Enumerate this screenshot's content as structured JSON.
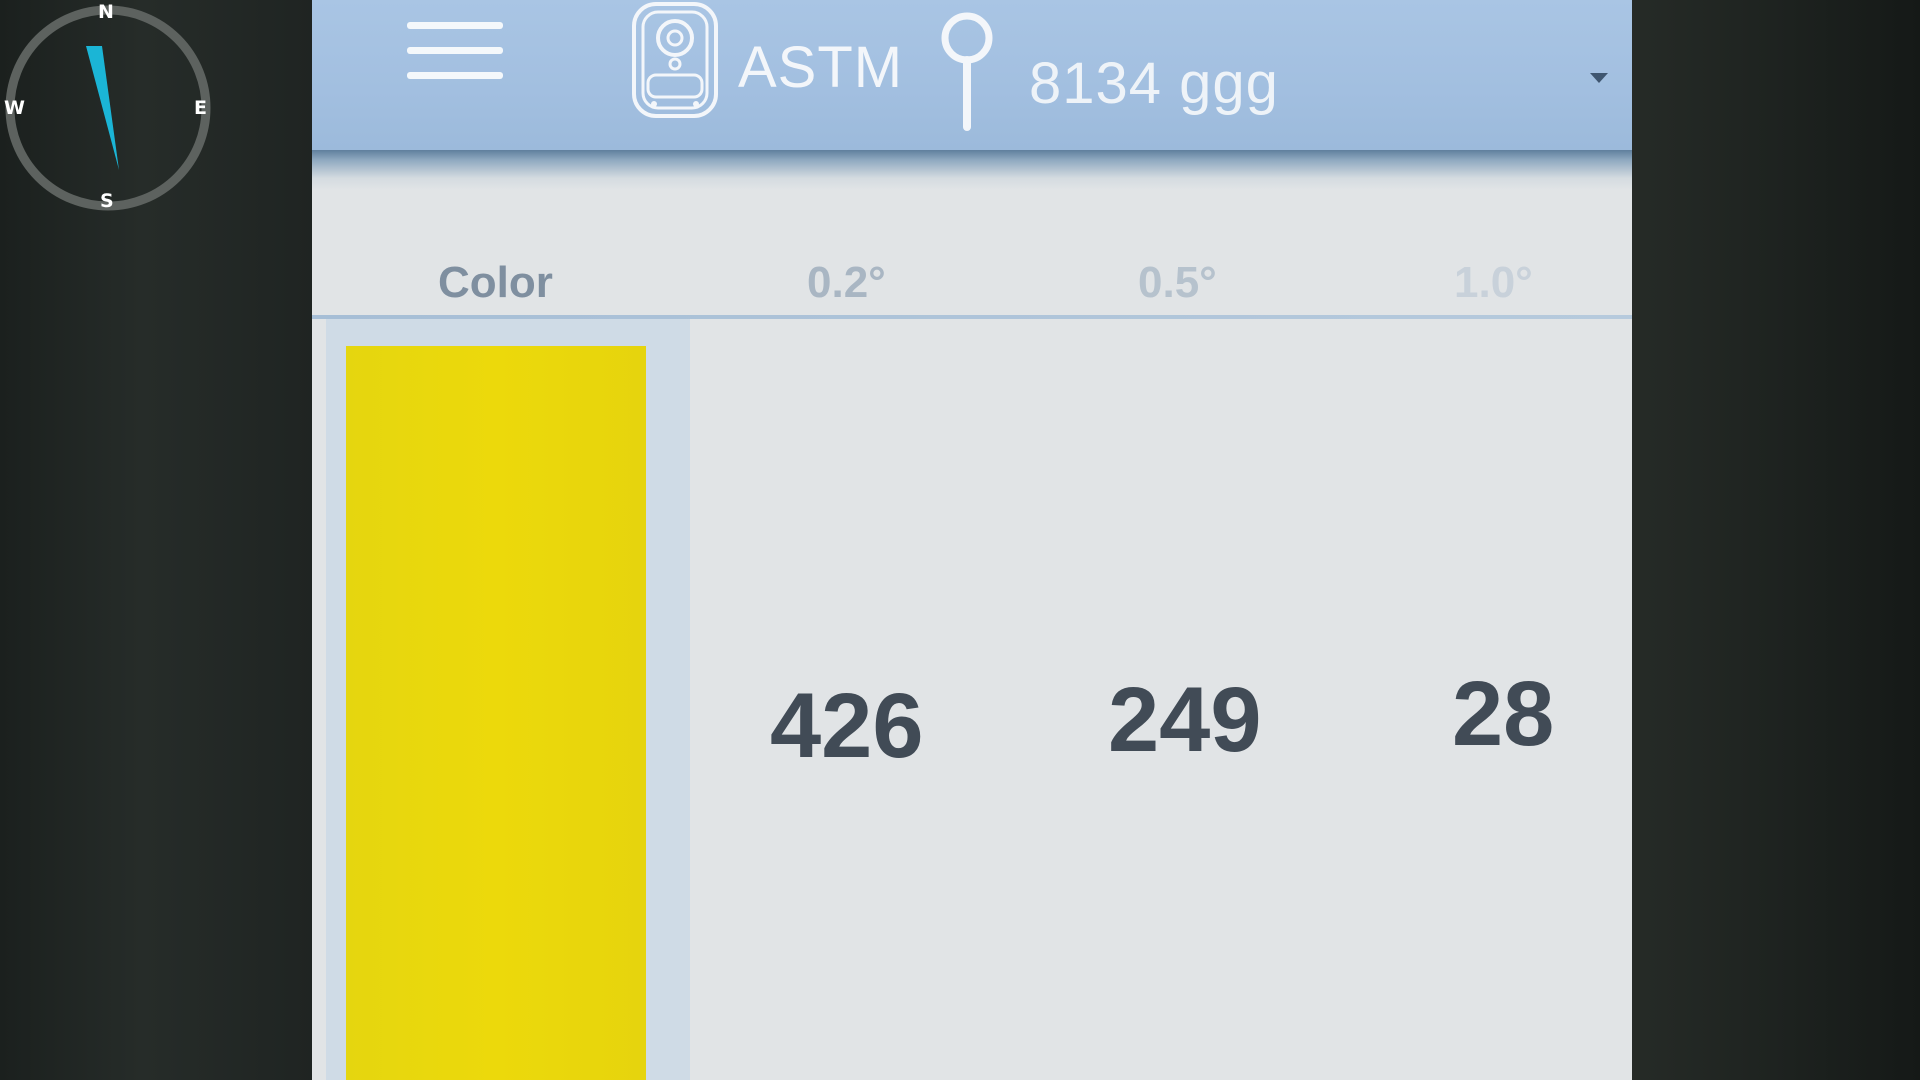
{
  "compass": {
    "north": "N",
    "south": "S",
    "east": "E",
    "west": "W",
    "needle_color": "#1bb5d6"
  },
  "header": {
    "menu_icon": "hamburger-menu-icon",
    "device_icon": "colorimeter-device-icon",
    "standard": "ASTM",
    "location_icon": "location-pin-icon",
    "sample": "8134 ggg",
    "dropdown_icon": "caret-down-icon",
    "bar_color": "#a7c3e2"
  },
  "table": {
    "columns": [
      "Color",
      "0.2°",
      "0.5°",
      "1.0°"
    ],
    "row": {
      "swatch_color": "#e8d70e",
      "values": [
        "426",
        "249",
        "28"
      ]
    }
  }
}
